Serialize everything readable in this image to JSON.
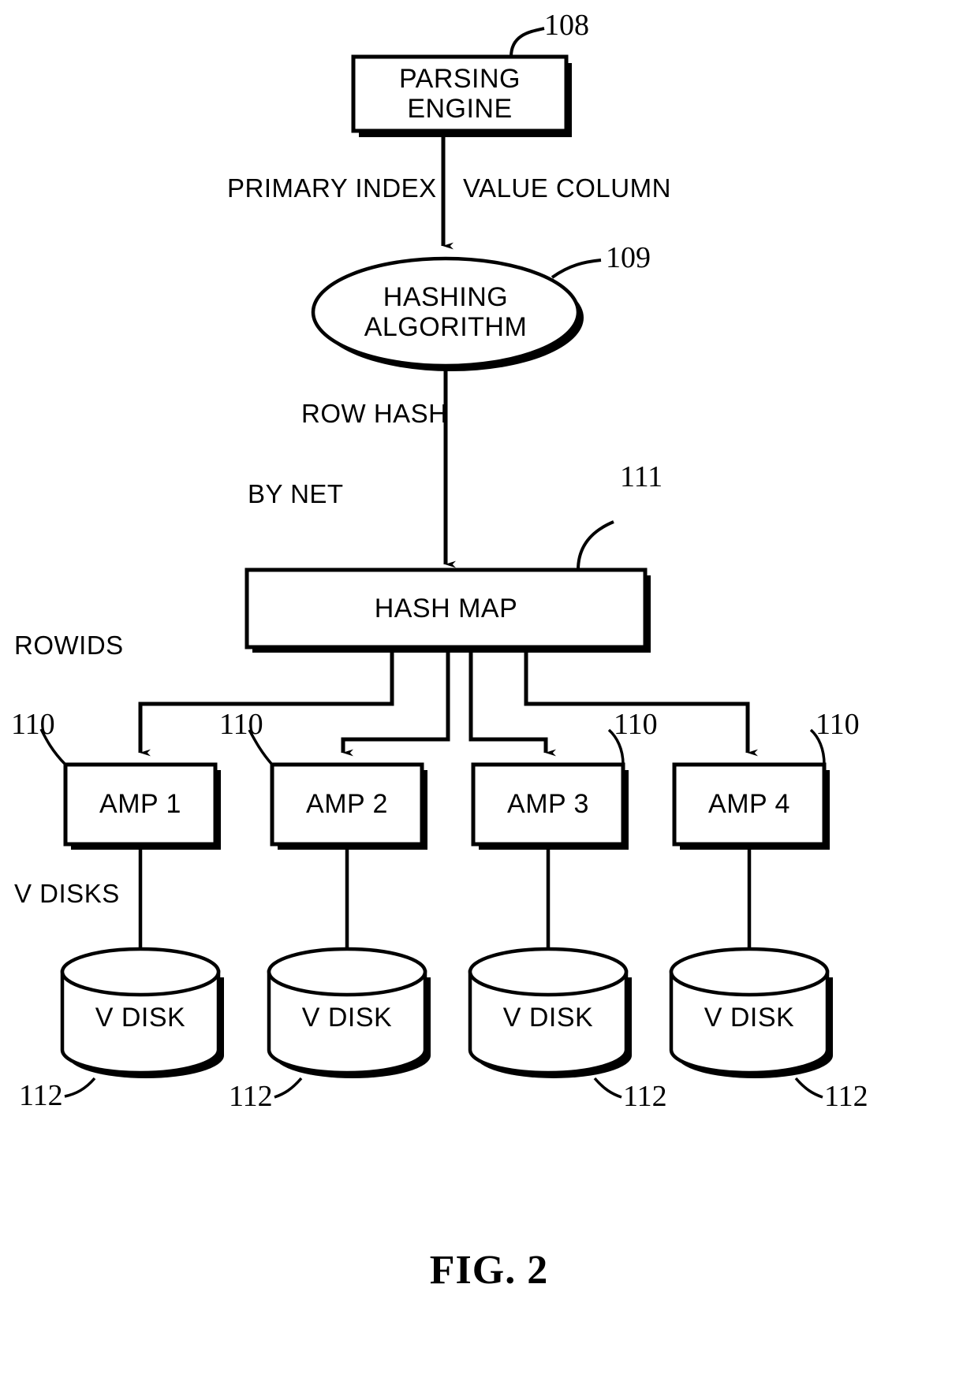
{
  "figure": {
    "caption": "FIG. 2",
    "title": "Parsing engine hashing and AMP distribution diagram"
  },
  "nodes": {
    "parsing_engine": {
      "label": "PARSING ENGINE",
      "ref": "108"
    },
    "hashing_algorithm": {
      "label": "HASHING\nALGORITHM",
      "ref": "109"
    },
    "hash_map": {
      "label": "HASH MAP",
      "ref": "111"
    }
  },
  "edge_labels": {
    "primary_index": "PRIMARY INDEX",
    "value_column": "VALUE COLUMN",
    "row_hash": "ROW HASH",
    "by_net": "BY NET",
    "rowids": "ROWIDS",
    "v_disks": "V DISKS"
  },
  "amps": [
    {
      "label": "AMP 1",
      "ref": "110"
    },
    {
      "label": "AMP 2",
      "ref": "110"
    },
    {
      "label": "AMP 3",
      "ref": "110"
    },
    {
      "label": "AMP 4",
      "ref": "110"
    }
  ],
  "vdisks": [
    {
      "label": "V DISK",
      "ref": "112"
    },
    {
      "label": "V DISK",
      "ref": "112"
    },
    {
      "label": "V DISK",
      "ref": "112"
    },
    {
      "label": "V DISK",
      "ref": "112"
    }
  ],
  "colors": {
    "line": "#000000",
    "background": "#ffffff"
  }
}
